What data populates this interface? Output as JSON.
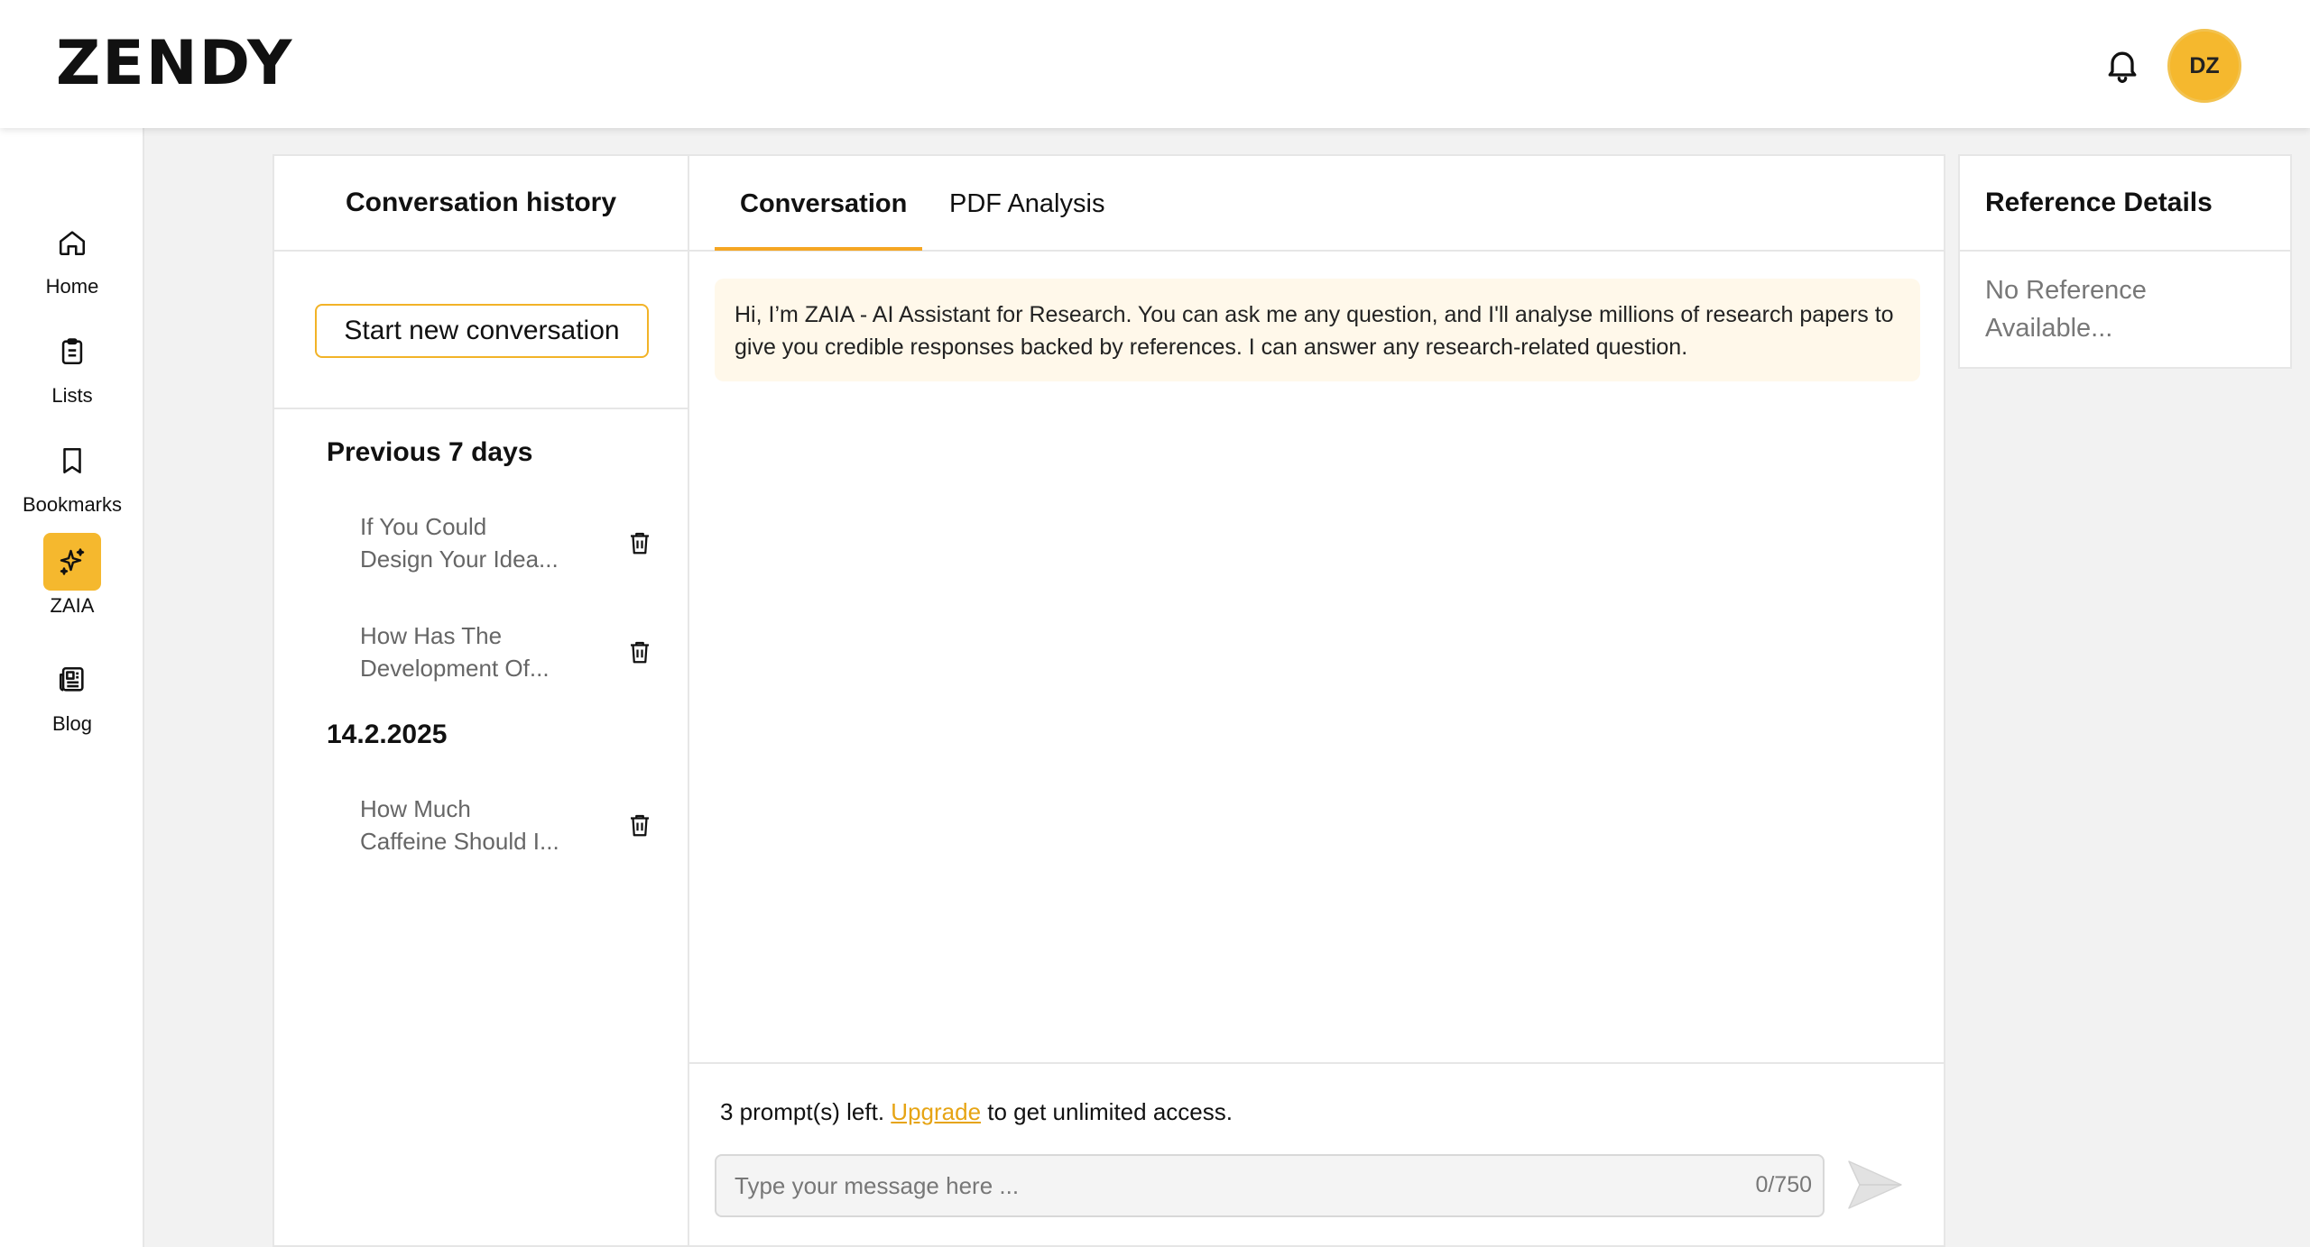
{
  "header": {
    "logo": "ZENDY",
    "avatar_initials": "DZ",
    "accent_color": "#f5b82e"
  },
  "sidebar": {
    "items": [
      {
        "label": "Home",
        "icon": "home-icon"
      },
      {
        "label": "Lists",
        "icon": "clipboard-icon"
      },
      {
        "label": "Bookmarks",
        "icon": "bookmark-icon"
      },
      {
        "label": "ZAIA",
        "icon": "sparkle-icon",
        "active": true
      },
      {
        "label": "Blog",
        "icon": "newspaper-icon"
      }
    ]
  },
  "history": {
    "title": "Conversation history",
    "new_button": "Start new conversation",
    "groups": [
      {
        "title": "Previous 7 days",
        "items": [
          {
            "line1": "If You Could",
            "line2": "Design Your Idea..."
          },
          {
            "line1": "How Has The",
            "line2": "Development Of..."
          }
        ]
      },
      {
        "title": "14.2.2025",
        "items": [
          {
            "line1": "How Much",
            "line2": "Caffeine Should I..."
          }
        ]
      }
    ]
  },
  "chat": {
    "tabs": [
      {
        "label": "Conversation",
        "active": true
      },
      {
        "label": "PDF Analysis",
        "active": false
      }
    ],
    "greeting": "Hi, I’m ZAIA - AI Assistant for Research. You can ask me any question, and I'll analyse millions of research papers to give you credible responses backed by references. I can answer any research-related question.",
    "prompts_left_prefix": "3 prompt(s) left.",
    "upgrade_link": "Upgrade",
    "prompts_left_suffix": "to get unlimited access.",
    "input_placeholder": "Type your message here ...",
    "input_value": "",
    "char_count": "0/750"
  },
  "reference": {
    "title": "Reference Details",
    "empty_line1": "No Reference",
    "empty_line2": "Available..."
  }
}
